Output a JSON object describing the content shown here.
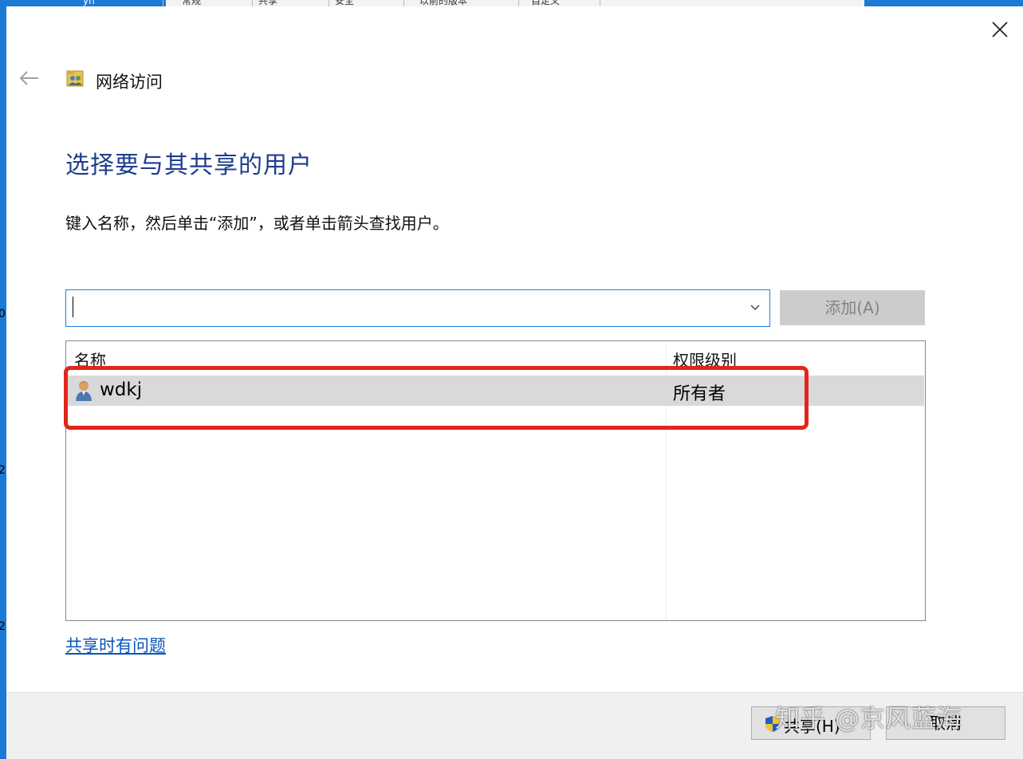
{
  "background": {
    "tabs": [
      "yn",
      "常规",
      "共享",
      "安全",
      "以前的版本",
      "自定义"
    ],
    "edge_numbers": [
      "0",
      "2",
      "2"
    ]
  },
  "dialog": {
    "close_label": "关闭",
    "breadcrumb": {
      "icon": "network-users-icon",
      "title": "网络访问"
    },
    "heading": "选择要与其共享的用户",
    "instruction": "键入名称，然后单击“添加”，或者单击箭头查找用户。",
    "input": {
      "value": "",
      "placeholder": ""
    },
    "add_button": "添加(A)",
    "list": {
      "columns": [
        "名称",
        "权限级别"
      ],
      "rows": [
        {
          "name": "wdkj",
          "permission": "所有者",
          "icon": "user-icon"
        }
      ]
    },
    "help_link": "共享时有问题",
    "share_button": "共享(H)",
    "cancel_button": "取消"
  },
  "watermark": "知乎 @京风蓝海",
  "colors": {
    "heading": "#1e3d8c",
    "link": "#0a54b8",
    "highlight": "#e1261c",
    "focus_border": "#1e7fd6"
  }
}
